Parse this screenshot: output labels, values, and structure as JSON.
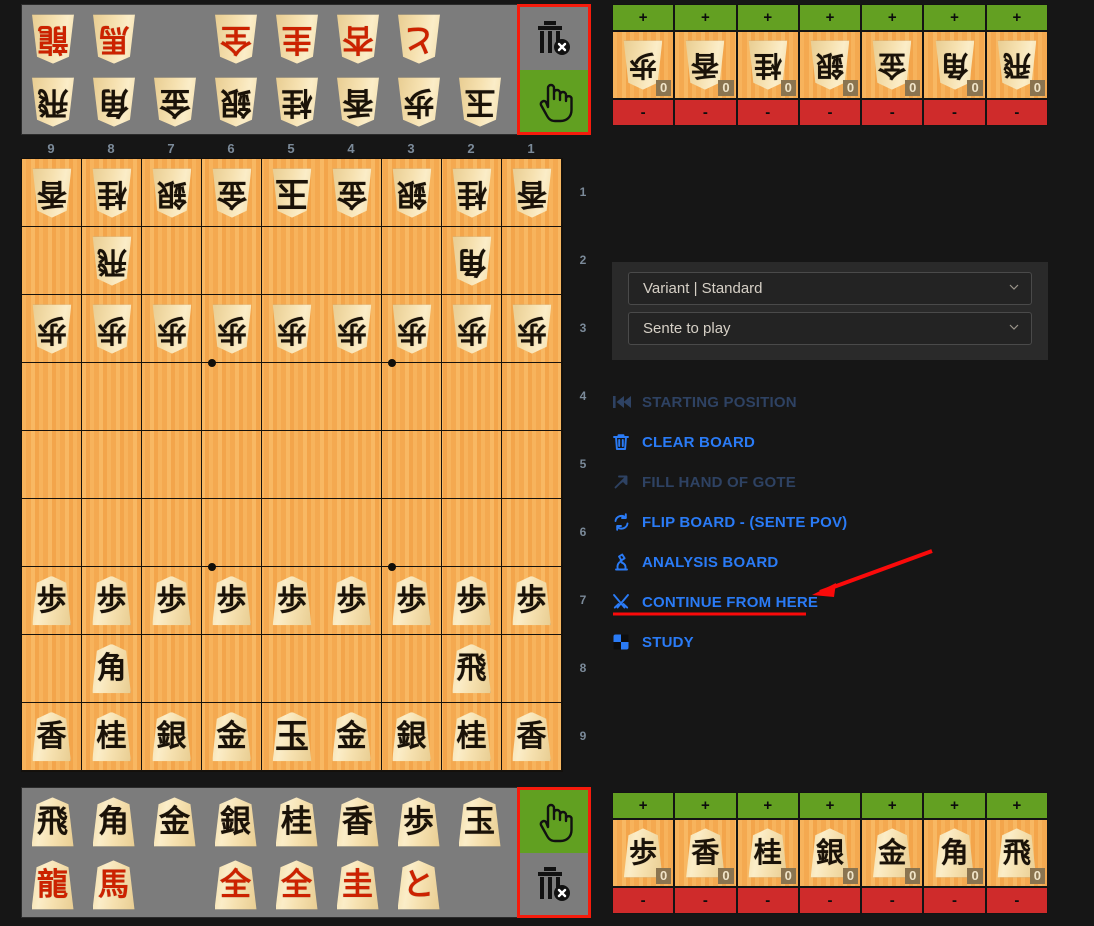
{
  "board": {
    "files": [
      "9",
      "8",
      "7",
      "6",
      "5",
      "4",
      "3",
      "2",
      "1"
    ],
    "ranks": [
      "1",
      "2",
      "3",
      "4",
      "5",
      "6",
      "7",
      "8",
      "9"
    ],
    "squares": [
      [
        {
          "g": "香",
          "s": "gote"
        },
        {
          "g": "桂",
          "s": "gote"
        },
        {
          "g": "銀",
          "s": "gote"
        },
        {
          "g": "金",
          "s": "gote"
        },
        {
          "g": "玉",
          "s": "gote",
          "big": true
        },
        {
          "g": "金",
          "s": "gote"
        },
        {
          "g": "銀",
          "s": "gote"
        },
        {
          "g": "桂",
          "s": "gote"
        },
        {
          "g": "香",
          "s": "gote"
        }
      ],
      [
        {
          "g": ""
        },
        {
          "g": "飛",
          "s": "gote"
        },
        {
          "g": ""
        },
        {
          "g": ""
        },
        {
          "g": ""
        },
        {
          "g": ""
        },
        {
          "g": ""
        },
        {
          "g": "角",
          "s": "gote"
        },
        {
          "g": ""
        }
      ],
      [
        {
          "g": "歩",
          "s": "gote"
        },
        {
          "g": "歩",
          "s": "gote"
        },
        {
          "g": "歩",
          "s": "gote"
        },
        {
          "g": "歩",
          "s": "gote"
        },
        {
          "g": "歩",
          "s": "gote"
        },
        {
          "g": "歩",
          "s": "gote"
        },
        {
          "g": "歩",
          "s": "gote"
        },
        {
          "g": "歩",
          "s": "gote"
        },
        {
          "g": "歩",
          "s": "gote"
        }
      ],
      [
        {
          "g": ""
        },
        {
          "g": ""
        },
        {
          "g": ""
        },
        {
          "g": ""
        },
        {
          "g": ""
        },
        {
          "g": ""
        },
        {
          "g": ""
        },
        {
          "g": ""
        },
        {
          "g": ""
        }
      ],
      [
        {
          "g": ""
        },
        {
          "g": ""
        },
        {
          "g": ""
        },
        {
          "g": ""
        },
        {
          "g": ""
        },
        {
          "g": ""
        },
        {
          "g": ""
        },
        {
          "g": ""
        },
        {
          "g": ""
        }
      ],
      [
        {
          "g": ""
        },
        {
          "g": ""
        },
        {
          "g": ""
        },
        {
          "g": ""
        },
        {
          "g": ""
        },
        {
          "g": ""
        },
        {
          "g": ""
        },
        {
          "g": ""
        },
        {
          "g": ""
        }
      ],
      [
        {
          "g": "歩",
          "s": "sente"
        },
        {
          "g": "歩",
          "s": "sente"
        },
        {
          "g": "歩",
          "s": "sente"
        },
        {
          "g": "歩",
          "s": "sente"
        },
        {
          "g": "歩",
          "s": "sente"
        },
        {
          "g": "歩",
          "s": "sente"
        },
        {
          "g": "歩",
          "s": "sente"
        },
        {
          "g": "歩",
          "s": "sente"
        },
        {
          "g": "歩",
          "s": "sente"
        }
      ],
      [
        {
          "g": ""
        },
        {
          "g": "角",
          "s": "sente"
        },
        {
          "g": ""
        },
        {
          "g": ""
        },
        {
          "g": ""
        },
        {
          "g": ""
        },
        {
          "g": ""
        },
        {
          "g": "飛",
          "s": "sente"
        },
        {
          "g": ""
        }
      ],
      [
        {
          "g": "香",
          "s": "sente"
        },
        {
          "g": "桂",
          "s": "sente"
        },
        {
          "g": "銀",
          "s": "sente"
        },
        {
          "g": "金",
          "s": "sente"
        },
        {
          "g": "玉",
          "s": "sente",
          "big": true
        },
        {
          "g": "金",
          "s": "sente"
        },
        {
          "g": "銀",
          "s": "sente"
        },
        {
          "g": "桂",
          "s": "sente"
        },
        {
          "g": "香",
          "s": "sente"
        }
      ]
    ]
  },
  "palette_top": {
    "side": "gote",
    "row1": [
      {
        "g": "龍",
        "promoted": true
      },
      {
        "g": "馬",
        "promoted": true
      },
      {
        "g": ""
      },
      {
        "g": "全",
        "promoted": true
      },
      {
        "g": "圭",
        "promoted": true
      },
      {
        "g": "杏",
        "promoted": true
      },
      {
        "g": "と",
        "promoted": true
      },
      {
        "g": ""
      }
    ],
    "row2": [
      {
        "g": "飛"
      },
      {
        "g": "角"
      },
      {
        "g": "金"
      },
      {
        "g": "銀"
      },
      {
        "g": "桂"
      },
      {
        "g": "香"
      },
      {
        "g": "歩"
      },
      {
        "g": "玉"
      }
    ]
  },
  "palette_bottom": {
    "side": "sente",
    "row1": [
      {
        "g": "飛"
      },
      {
        "g": "角"
      },
      {
        "g": "金"
      },
      {
        "g": "銀"
      },
      {
        "g": "桂"
      },
      {
        "g": "香"
      },
      {
        "g": "歩"
      },
      {
        "g": "玉"
      }
    ],
    "row2": [
      {
        "g": "龍",
        "promoted": true
      },
      {
        "g": "馬",
        "promoted": true
      },
      {
        "g": ""
      },
      {
        "g": "全",
        "promoted": true
      },
      {
        "g": "全",
        "promoted": true
      },
      {
        "g": "圭",
        "promoted": true
      },
      {
        "g": "と",
        "promoted": true
      },
      {
        "g": ""
      }
    ]
  },
  "toolbox_top": {
    "top_tool": {
      "icon": "trash-delete-icon",
      "active": false
    },
    "bottom_tool": {
      "icon": "hand-pointer-icon",
      "active": true
    },
    "highlighted": true
  },
  "toolbox_bottom": {
    "top_tool": {
      "icon": "hand-pointer-icon",
      "active": true
    },
    "bottom_tool": {
      "icon": "trash-delete-icon",
      "active": false
    },
    "highlighted": true
  },
  "hand_gote": {
    "side": "gote",
    "plus_label": "+",
    "minus_label": "-",
    "pieces": [
      {
        "g": "歩",
        "count": "0"
      },
      {
        "g": "香",
        "count": "0"
      },
      {
        "g": "桂",
        "count": "0"
      },
      {
        "g": "銀",
        "count": "0"
      },
      {
        "g": "金",
        "count": "0"
      },
      {
        "g": "角",
        "count": "0"
      },
      {
        "g": "飛",
        "count": "0"
      }
    ]
  },
  "hand_sente": {
    "side": "sente",
    "plus_label": "+",
    "minus_label": "-",
    "pieces": [
      {
        "g": "歩",
        "count": "0"
      },
      {
        "g": "香",
        "count": "0"
      },
      {
        "g": "桂",
        "count": "0"
      },
      {
        "g": "銀",
        "count": "0"
      },
      {
        "g": "金",
        "count": "0"
      },
      {
        "g": "角",
        "count": "0"
      },
      {
        "g": "飛",
        "count": "0"
      }
    ]
  },
  "settings": {
    "variant_select": "Variant | Standard",
    "turn_select": "Sente to play"
  },
  "actions": [
    {
      "label": "STARTING POSITION",
      "icon": "skip-back-icon",
      "disabled": true
    },
    {
      "label": "CLEAR BOARD",
      "icon": "trash-icon",
      "disabled": false
    },
    {
      "label": "FILL HAND OF GOTE",
      "icon": "arrow-up-right-icon",
      "disabled": true
    },
    {
      "label": "FLIP BOARD - (SENTE POV)",
      "icon": "refresh-icon",
      "disabled": false
    },
    {
      "label": "ANALYSIS BOARD",
      "icon": "microscope-icon",
      "disabled": false
    },
    {
      "label": "CONTINUE FROM HERE",
      "icon": "swords-icon",
      "disabled": false
    },
    {
      "label": "STUDY",
      "icon": "study-board-icon",
      "disabled": false
    }
  ],
  "annotations": {
    "arrow_color": "#fa0a0a",
    "underline_color": "#fa0a0a",
    "box_color": "#f51b0c",
    "target_label": "CONTINUE FROM HERE"
  },
  "colors": {
    "board": "#f5ab51",
    "palette_bg": "#7c7c7c",
    "accent_link": "#2a7bf6",
    "plus_green": "#63a022",
    "minus_red": "#cf2b2b",
    "page_bg": "#161616"
  }
}
